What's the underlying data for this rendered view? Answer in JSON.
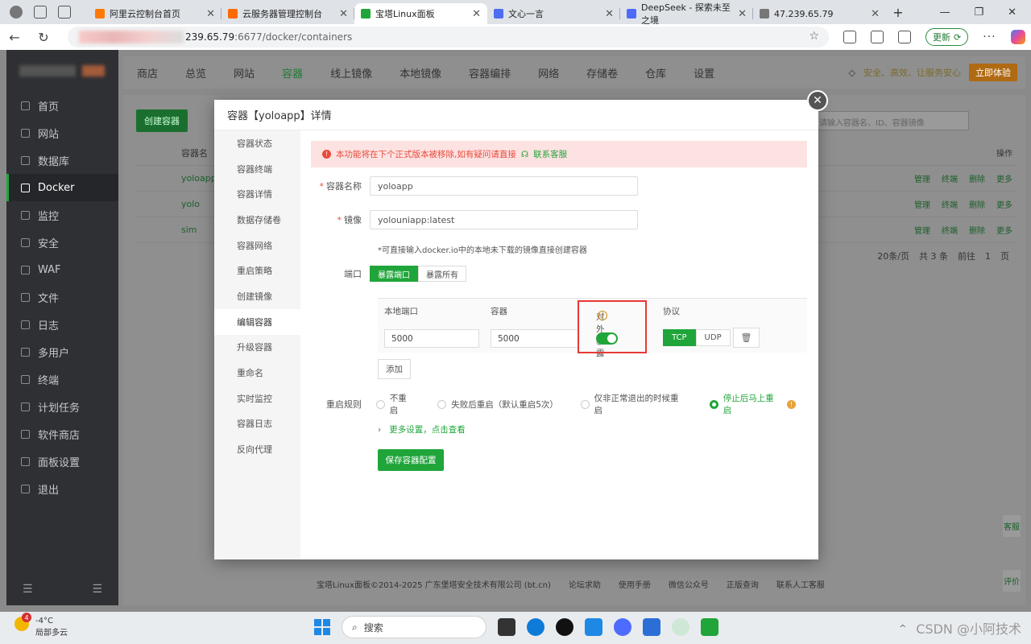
{
  "browser": {
    "tabs": [
      {
        "title": "阿里云控制台首页",
        "color": "#ff7a00"
      },
      {
        "title": "云服务器管理控制台",
        "color": "#ff6a00"
      },
      {
        "title": "宝塔Linux面板",
        "color": "#20a53a"
      },
      {
        "title": "文心一言",
        "color": "#4e6ef2"
      },
      {
        "title": "DeepSeek - 探索未至之境",
        "color": "#4d6bfe"
      },
      {
        "title": "47.239.65.79",
        "color": "#777777"
      }
    ],
    "url_host": "239.65.79",
    "url_path": ":6677/docker/containers",
    "update_label": "更新"
  },
  "topnav": {
    "items": [
      "商店",
      "总览",
      "网站",
      "容器",
      "线上镜像",
      "本地镜像",
      "容器编排",
      "网络",
      "存储卷",
      "仓库",
      "设置"
    ],
    "active": "容器",
    "safe_text": "安全、高效、让服务安心",
    "buy_label": "立即体验"
  },
  "sidebar": {
    "items": [
      {
        "label": "首页",
        "active": false
      },
      {
        "label": "网站",
        "active": false
      },
      {
        "label": "数据库",
        "active": false
      },
      {
        "label": "Docker",
        "active": true
      },
      {
        "label": "监控",
        "active": false
      },
      {
        "label": "安全",
        "active": false
      },
      {
        "label": "WAF",
        "active": false
      },
      {
        "label": "文件",
        "active": false
      },
      {
        "label": "日志",
        "active": false
      },
      {
        "label": "多用户",
        "active": false
      },
      {
        "label": "终端",
        "active": false
      },
      {
        "label": "计划任务",
        "active": false
      },
      {
        "label": "软件商店",
        "active": false
      },
      {
        "label": "面板设置",
        "active": false
      },
      {
        "label": "退出",
        "active": false
      }
    ]
  },
  "background": {
    "create_btn": "创建容器",
    "search_placeholder": "请输入容器名、ID、容器镜像",
    "col_name": "容器名",
    "col_ops": "操作",
    "rows": [
      "yoloapp",
      "yolo",
      "sim"
    ],
    "ops": [
      "管理",
      "终端",
      "删除",
      "更多"
    ],
    "page_size": "20条/页",
    "total": "共 3 条",
    "goto": "前往",
    "page": "1",
    "page_unit": "页",
    "footer": [
      "宝塔Linux面板©2014-2025 广东堡塔安全技术有限公司 (bt.cn)",
      "论坛求助",
      "使用手册",
      "微信公众号",
      "正版查询",
      "联系人工客服"
    ],
    "float_service": "客服",
    "float_review": "评价"
  },
  "modal": {
    "title": "容器【yoloapp】详情",
    "menu": [
      {
        "label": "容器状态",
        "active": false
      },
      {
        "label": "容器终端",
        "active": false
      },
      {
        "label": "容器详情",
        "active": false
      },
      {
        "label": "数据存储卷",
        "active": false
      },
      {
        "label": "容器网络",
        "active": false
      },
      {
        "label": "重启策略",
        "active": false
      },
      {
        "label": "创建镜像",
        "active": false
      },
      {
        "label": "编辑容器",
        "active": true
      },
      {
        "label": "升级容器",
        "active": false
      },
      {
        "label": "重命名",
        "active": false
      },
      {
        "label": "实时监控",
        "active": false
      },
      {
        "label": "容器日志",
        "active": false
      },
      {
        "label": "反向代理",
        "active": false
      }
    ],
    "alert_text": "本功能将在下个正式版本被移除,如有疑问请直接",
    "alert_link": "联系客服",
    "name_label": "容器名称",
    "name_value": "yoloapp",
    "image_label": "镜像",
    "image_value": "yolouniapp:latest",
    "image_hint": "*可直接输入docker.io中的本地未下载的镜像直接创建容器",
    "port_label": "端口",
    "port_seg": [
      "暴露端口",
      "暴露所有"
    ],
    "port_headers": {
      "local": "本地端口",
      "container": "容器",
      "expose": "对外暴露",
      "protocol": "协议"
    },
    "port_row": {
      "local": "5000",
      "container": "5000",
      "expose_on": true
    },
    "protocols": [
      "TCP",
      "UDP"
    ],
    "active_protocol": "TCP",
    "add_label": "添加",
    "restart_label": "重启规则",
    "restart_options": [
      "不重启",
      "失败后重启（默认重启5次）",
      "仅非正常退出的时候重启",
      "停止后马上重启"
    ],
    "restart_selected": 3,
    "more_settings": "更多设置，点击查看",
    "save_label": "保存容器配置"
  },
  "taskbar": {
    "temp": "-4°C",
    "weather": "局部多云",
    "badge": "4",
    "search": "搜索",
    "watermark": "CSDN @小阿技术"
  }
}
